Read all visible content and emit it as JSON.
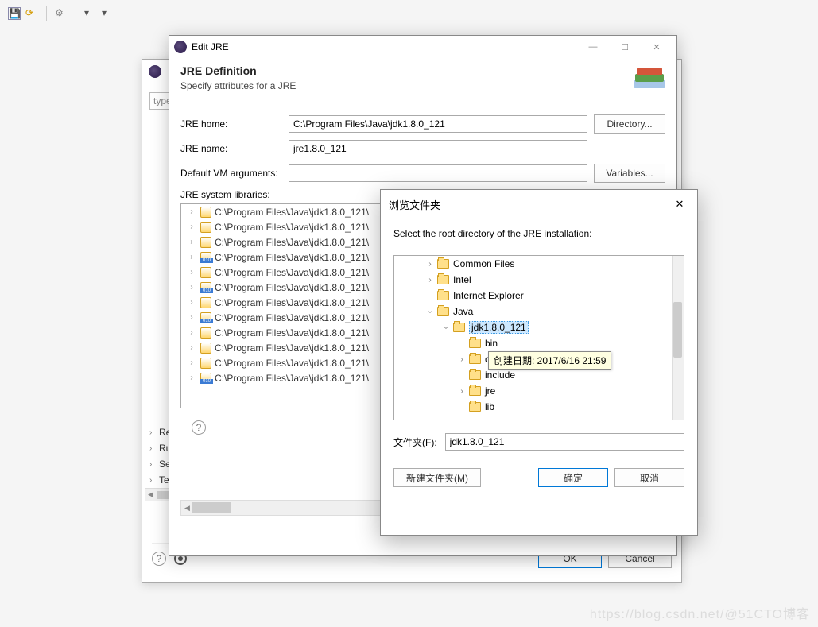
{
  "toolbar": {},
  "pref_back": {
    "search_placeholder": "type",
    "tree_items": [
      "Remote Systems",
      "Run/Debug",
      "Server",
      "Team"
    ],
    "ok_label": "OK",
    "cancel_label": "Cancel",
    "last_col": "e"
  },
  "edit_dialog": {
    "title": "Edit JRE",
    "header_title": "JRE Definition",
    "header_sub": "Specify attributes for a JRE",
    "jre_home_label": "JRE home:",
    "jre_home_value": "C:\\Program Files\\Java\\jdk1.8.0_121",
    "directory_btn": "Directory...",
    "jre_name_label": "JRE name:",
    "jre_name_value": "jre1.8.0_121",
    "vm_args_label": "Default VM arguments:",
    "vm_args_value": "",
    "variables_btn": "Variables...",
    "sys_lib_label": "JRE system libraries:",
    "lib_rows": [
      {
        "type": "jar",
        "text": "C:\\Program Files\\Java\\jdk1.8.0_121\\"
      },
      {
        "type": "jar",
        "text": "C:\\Program Files\\Java\\jdk1.8.0_121\\"
      },
      {
        "type": "jar",
        "text": "C:\\Program Files\\Java\\jdk1.8.0_121\\"
      },
      {
        "type": "blue",
        "text": "C:\\Program Files\\Java\\jdk1.8.0_121\\"
      },
      {
        "type": "jar",
        "text": "C:\\Program Files\\Java\\jdk1.8.0_121\\"
      },
      {
        "type": "blue",
        "text": "C:\\Program Files\\Java\\jdk1.8.0_121\\"
      },
      {
        "type": "jar",
        "text": "C:\\Program Files\\Java\\jdk1.8.0_121\\"
      },
      {
        "type": "blue",
        "text": "C:\\Program Files\\Java\\jdk1.8.0_121\\"
      },
      {
        "type": "jar",
        "text": "C:\\Program Files\\Java\\jdk1.8.0_121\\"
      },
      {
        "type": "jar",
        "text": "C:\\Program Files\\Java\\jdk1.8.0_121\\"
      },
      {
        "type": "jar",
        "text": "C:\\Program Files\\Java\\jdk1.8.0_121\\"
      },
      {
        "type": "blue",
        "text": "C:\\Program Files\\Java\\jdk1.8.0_121\\"
      }
    ]
  },
  "browse_dialog": {
    "title": "浏览文件夹",
    "instruction": "Select the root directory of the JRE installation:",
    "tree": {
      "common_files": "Common Files",
      "intel": "Intel",
      "ie": "Internet Explorer",
      "java": "Java",
      "jdk": "jdk1.8.0_121",
      "bin": "bin",
      "d": "d",
      "include": "include",
      "jre": "jre",
      "lib": "lib"
    },
    "tooltip": "创建日期: 2017/6/16 21:59",
    "folder_label": "文件夹(F):",
    "folder_value": "jdk1.8.0_121",
    "new_folder_btn": "新建文件夹(M)",
    "ok_btn": "确定",
    "cancel_btn": "取消"
  },
  "watermark": "https://blog.csdn.net/@51CTO博客"
}
